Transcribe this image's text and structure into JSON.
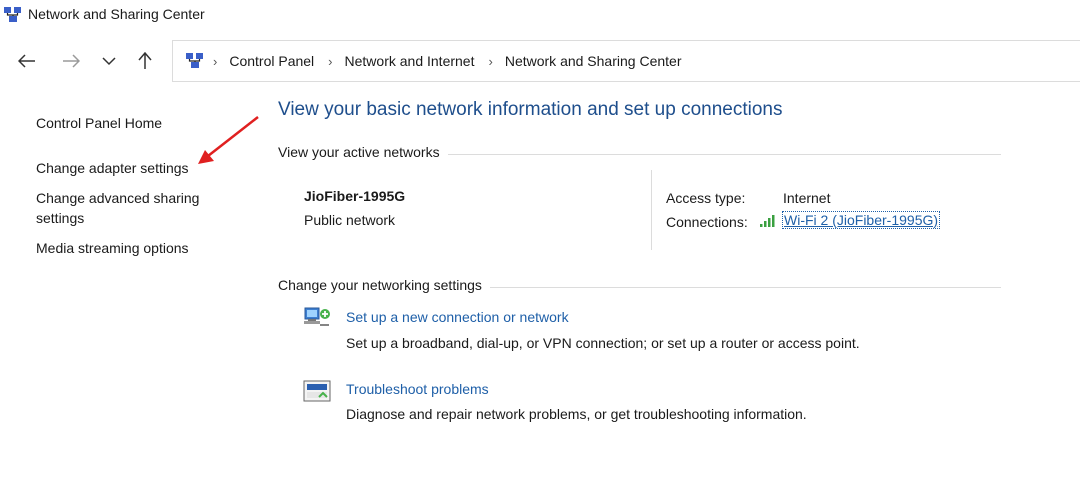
{
  "window": {
    "title": "Network and Sharing Center"
  },
  "nav": {
    "back": "back-arrow",
    "forward": "forward-arrow",
    "recent": "chevron-down",
    "up": "up-arrow"
  },
  "breadcrumb": [
    "Control Panel",
    "Network and Internet",
    "Network and Sharing Center"
  ],
  "sidebar": {
    "home": "Control Panel Home",
    "adapter": "Change adapter settings",
    "advanced_line1": "Change advanced sharing",
    "advanced_line2": "settings",
    "media": "Media streaming options"
  },
  "main": {
    "title": "View your basic network information and set up connections",
    "active_networks_header": "View your active networks",
    "network": {
      "name": "JioFiber-1995G",
      "category": "Public network",
      "access_type_label": "Access type:",
      "access_type_value": "Internet",
      "connections_label": "Connections:",
      "connection_link": "Wi-Fi 2 (JioFiber-1995G)"
    },
    "settings_header": "Change your networking settings",
    "tasks": [
      {
        "link": "Set up a new connection or network",
        "desc": "Set up a broadband, dial-up, or VPN connection; or set up a router or access point."
      },
      {
        "link": "Troubleshoot problems",
        "desc": "Diagnose and repair network problems, or get troubleshooting information."
      }
    ]
  },
  "colors": {
    "link": "#1e5fa8",
    "title": "#1e4e8c",
    "annotation_arrow": "#e02020"
  }
}
